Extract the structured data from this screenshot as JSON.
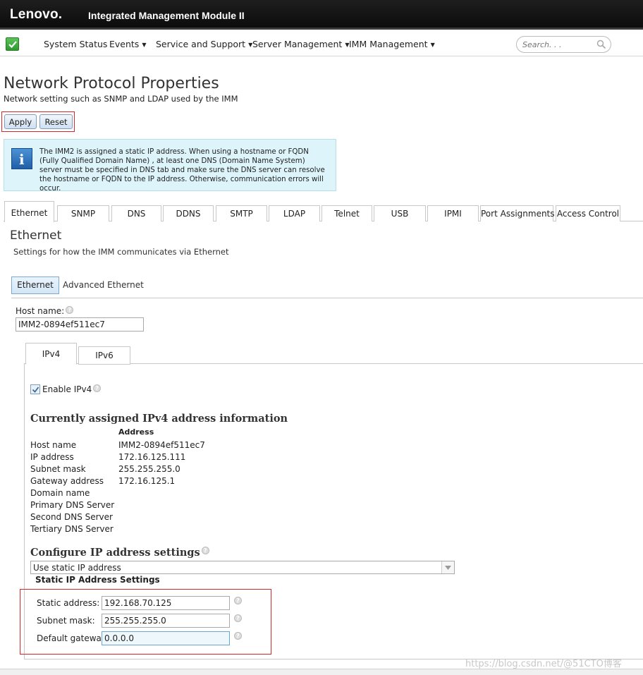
{
  "header": {
    "logo": "Lenovo.",
    "title": "Integrated Management Module II"
  },
  "nav": {
    "items": [
      "System Status",
      "Events",
      "Service and Support",
      "Server Management",
      "IMM Management"
    ],
    "search_placeholder": "Search. . ."
  },
  "page": {
    "title": "Network Protocol Properties",
    "subtitle": "Network setting such as SNMP and LDAP used by the IMM",
    "apply_label": "Apply",
    "reset_label": "Reset"
  },
  "info": {
    "text": "The IMM2 is assigned a static IP address. When using a hostname or FQDN (Fully Qualified Domain Name) , at least one DNS (Domain Name System) server must be specified in DNS tab and make sure the DNS server can resolve the hostname or FQDN to the IP address. Otherwise, communication errors will occur."
  },
  "tabs": [
    "Ethernet",
    "SNMP",
    "DNS",
    "DDNS",
    "SMTP",
    "LDAP",
    "Telnet",
    "USB",
    "IPMI",
    "Port Assignments",
    "Access Control"
  ],
  "ethernet": {
    "title": "Ethernet",
    "subtitle": "Settings for how the IMM communicates via Ethernet",
    "subtab_active": "Ethernet",
    "subtab_other": "Advanced Ethernet",
    "hostname_label": "Host name:",
    "hostname_value": "IMM2-0894ef511ec7"
  },
  "ip": {
    "tab_v4": "IPv4",
    "tab_v6": "IPv6",
    "enable_label": "Enable IPv4",
    "current_title": "Currently assigned IPv4 address information",
    "address_header": "Address",
    "rows": [
      {
        "label": "Host name",
        "value": "IMM2-0894ef511ec7"
      },
      {
        "label": "IP address",
        "value": "172.16.125.111"
      },
      {
        "label": "Subnet mask",
        "value": "255.255.255.0"
      },
      {
        "label": "Gateway address",
        "value": "172.16.125.1"
      },
      {
        "label": "Domain name",
        "value": ""
      },
      {
        "label": "Primary DNS Server",
        "value": ""
      },
      {
        "label": "Second DNS Server",
        "value": ""
      },
      {
        "label": "Tertiary DNS Server",
        "value": ""
      }
    ],
    "configure_title": "Configure IP address settings",
    "mode_value": "Use static IP address",
    "static_title": "Static IP Address Settings",
    "static_address_label": "Static address:",
    "static_address_value": "192.168.70.125",
    "subnet_label": "Subnet mask:",
    "subnet_value": "255.255.255.0",
    "gateway_label": "Default gateway:",
    "gateway_value": "0.0.0.0"
  },
  "watermark": "https://blog.csdn.net/@51CTO博客",
  "colors": {
    "header_bg": "#111111",
    "highlight_red": "#d9262b",
    "info_bg": "#ddf4fb",
    "button_blue": "#cfe0f1"
  }
}
